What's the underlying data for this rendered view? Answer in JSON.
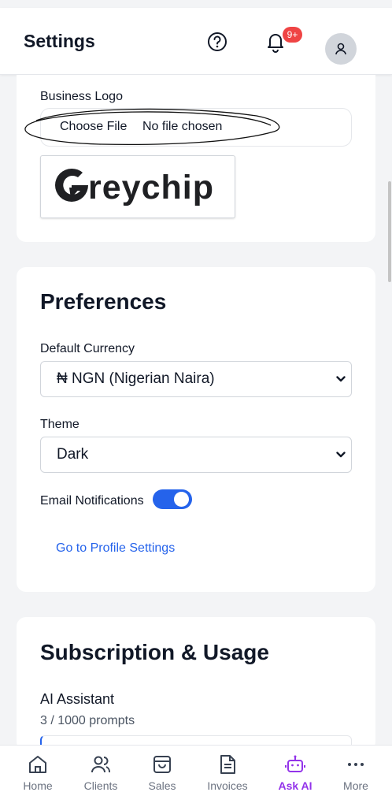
{
  "header": {
    "title": "Settings",
    "notification_count": "9+"
  },
  "business": {
    "logo_label": "Business Logo",
    "file_button": "Choose File",
    "file_status": "No file chosen",
    "logo_text": "reychip"
  },
  "preferences": {
    "title": "Preferences",
    "currency_label": "Default Currency",
    "currency_value": "₦ NGN (Nigerian Naira)",
    "theme_label": "Theme",
    "theme_value": "Dark",
    "email_label": "Email Notifications",
    "email_enabled": true,
    "profile_link": "Go to Profile Settings"
  },
  "subscription": {
    "title": "Subscription & Usage",
    "ai_label": "AI Assistant",
    "ai_usage": "3 / 1000 prompts"
  },
  "nav": {
    "items": [
      {
        "label": "Home",
        "icon": "home-icon"
      },
      {
        "label": "Clients",
        "icon": "users-icon"
      },
      {
        "label": "Sales",
        "icon": "shopping-bag-icon"
      },
      {
        "label": "Invoices",
        "icon": "document-icon"
      },
      {
        "label": "Ask AI",
        "icon": "robot-icon"
      },
      {
        "label": "More",
        "icon": "more-icon"
      }
    ],
    "active": "Ask AI"
  },
  "colors": {
    "accent": "#2563eb",
    "nav_active": "#9333ea",
    "badge": "#ef4444"
  }
}
